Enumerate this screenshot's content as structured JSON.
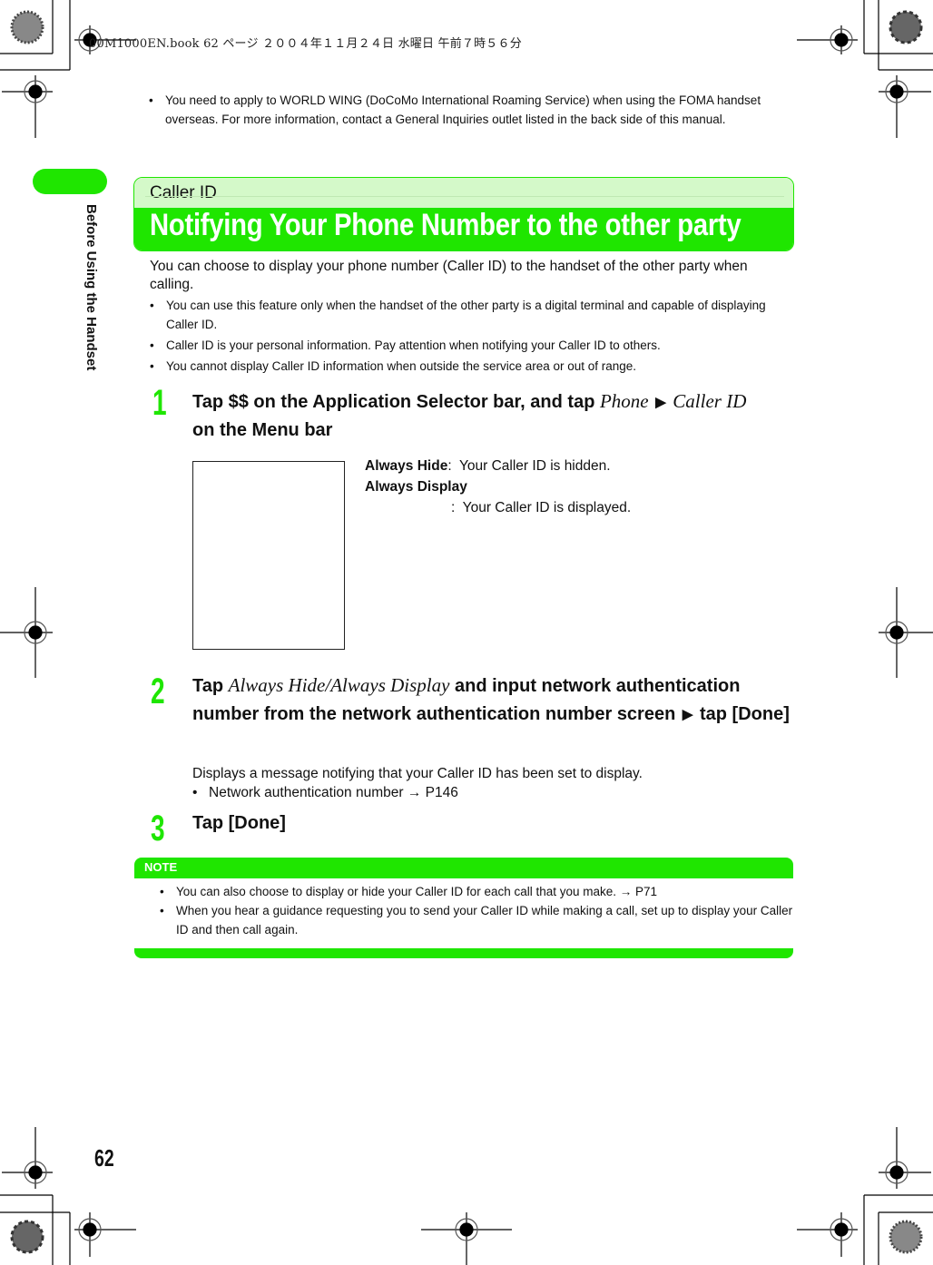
{
  "print_header": "00M1000EN.book  62 ページ  ２００４年１１月２４日  水曜日  午前７時５６分",
  "side_tab": {
    "label": "Before Using the Handset",
    "color": "#1fe600"
  },
  "top_note": {
    "bullets": [
      "You need to apply to WORLD WING (DoCoMo International Roaming Service) when using the FOMA handset overseas. For more information, contact a General Inquiries outlet listed in the back side of this manual."
    ]
  },
  "title_box": {
    "category": "Caller ID",
    "title": "Notifying Your Phone Number to the other party",
    "accent_color": "#1fe600",
    "sub_bg_color": "#d4f9c9"
  },
  "intro": {
    "text": "You can choose to display your phone number (Caller ID) to the handset of the other party when calling.",
    "bullets": [
      "You can use this feature only when the handset of the other party is a digital terminal and capable of displaying Caller ID.",
      "Caller ID is your personal information. Pay attention when notifying your Caller ID to others.",
      "You cannot display Caller ID information when outside the service area or out of range."
    ]
  },
  "steps": [
    {
      "number": "1",
      "parts": {
        "a": "Tap $$ on the Application Selector bar, and tap ",
        "b": "Phone",
        "arrow": "▶",
        "c": "Caller ID",
        "d": "on the Menu bar"
      },
      "options": [
        {
          "term": "Always Hide",
          "sep": ":",
          "desc": "Your Caller ID is hidden."
        },
        {
          "term": "Always Display",
          "sep": ":",
          "desc": "Your Caller ID is displayed."
        }
      ]
    },
    {
      "number": "2",
      "parts": {
        "a": "Tap ",
        "b": "Always Hide/Always Display",
        "c": " and input network authentication number from the network authentication number screen ",
        "arrow": "▶",
        "d": " tap [Done]"
      },
      "description": "Displays a message notifying that your Caller ID has been set to display.",
      "bullets": [
        {
          "text": "Network authentication number",
          "ref": "→ P146"
        }
      ]
    },
    {
      "number": "3",
      "text": "Tap [Done]"
    }
  ],
  "note": {
    "heading": "NOTE",
    "bullets": [
      {
        "text": "You can also choose to display or hide your Caller ID for each call that you make. ",
        "ref": "→ P71"
      },
      {
        "text": "When you hear a guidance requesting you to send your Caller ID while making a call, set up to display your Caller ID and then call again.",
        "ref": ""
      }
    ]
  },
  "page_number": "62"
}
